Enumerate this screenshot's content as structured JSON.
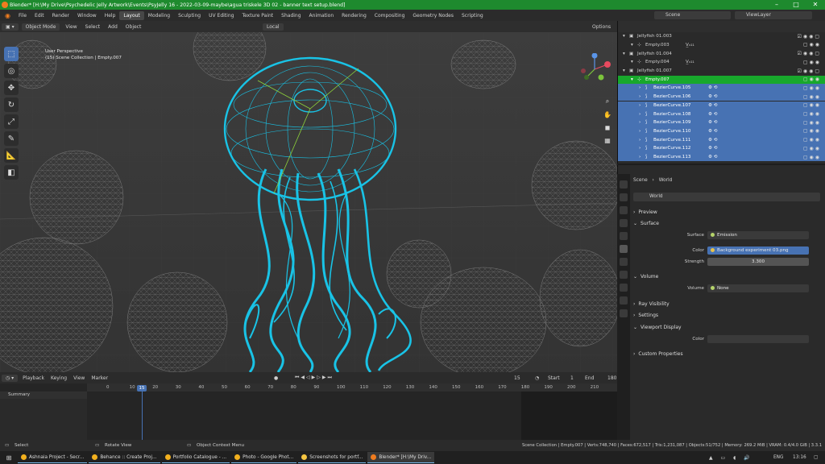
{
  "window": {
    "title": "Blender* [H:\\My Drive\\Psychedelic Jelly Artwork\\Events\\PsyJelly 16 - 2022-03-09-maybe\\agua triskele 3D 02 - banner text setup.blend]"
  },
  "menu": [
    "File",
    "Edit",
    "Render",
    "Window",
    "Help"
  ],
  "workspaces": [
    "Layout",
    "Modeling",
    "Sculpting",
    "UV Editing",
    "Texture Paint",
    "Shading",
    "Animation",
    "Rendering",
    "Compositing",
    "Geometry Nodes",
    "Scripting"
  ],
  "active_workspace": "Layout",
  "scene": {
    "scene_label": "Scene",
    "view_layer_label": "ViewLayer"
  },
  "viewport": {
    "mode": "Object Mode",
    "menu": [
      "View",
      "Select",
      "Add",
      "Object"
    ],
    "transform": "Local",
    "options": "Options",
    "perspective": "User Perspective",
    "collection_info": "(15) Scene Collection | Empty.007"
  },
  "tools": [
    "select-box",
    "cursor",
    "move",
    "rotate",
    "scale",
    "transform",
    "annotate",
    "measure",
    "add-cube"
  ],
  "outliner": {
    "rows": [
      {
        "label": "Jellyfish 01.003",
        "indent": 1,
        "state": "normal",
        "extra": ""
      },
      {
        "label": "Empty.003",
        "indent": 2,
        "state": "normal",
        "extra": "V̲ₓ₁₁"
      },
      {
        "label": "Jellyfish 01.004",
        "indent": 1,
        "state": "normal",
        "extra": ""
      },
      {
        "label": "Empty.004",
        "indent": 2,
        "state": "normal",
        "extra": "V̲ₓ₁₁"
      },
      {
        "label": "Jellyfish 01.007",
        "indent": 1,
        "state": "normal",
        "extra": ""
      },
      {
        "label": "Empty.007",
        "indent": 2,
        "state": "active",
        "extra": ""
      },
      {
        "label": "BezierCurve.105",
        "indent": 3,
        "state": "sel",
        "extra": ""
      },
      {
        "label": "BezierCurve.106",
        "indent": 3,
        "state": "sel",
        "extra": ""
      },
      {
        "label": "BezierCurve.107",
        "indent": 3,
        "state": "sel",
        "extra": ""
      },
      {
        "label": "BezierCurve.108",
        "indent": 3,
        "state": "sel",
        "extra": ""
      },
      {
        "label": "BezierCurve.109",
        "indent": 3,
        "state": "sel",
        "extra": ""
      },
      {
        "label": "BezierCurve.110",
        "indent": 3,
        "state": "sel",
        "extra": ""
      },
      {
        "label": "BezierCurve.111",
        "indent": 3,
        "state": "sel",
        "extra": ""
      },
      {
        "label": "BezierCurve.112",
        "indent": 3,
        "state": "sel",
        "extra": ""
      },
      {
        "label": "BezierCurve.113",
        "indent": 3,
        "state": "sel",
        "extra": ""
      }
    ]
  },
  "properties": {
    "breadcrumb": {
      "scene": "Scene",
      "world": "World"
    },
    "world_name": "World",
    "sections": {
      "preview": "Preview",
      "surface": "Surface",
      "volume": "Volume",
      "ray_visibility": "Ray Visibility",
      "settings": "Settings",
      "viewport_display": "Viewport Display",
      "custom": "Custom Properties"
    },
    "surface_label": "Surface",
    "surface_value": "Emission",
    "color_label": "Color",
    "color_value": "Background experiment 03.png",
    "strength_label": "Strength",
    "strength_value": "3.300",
    "volume_label": "Volume",
    "volume_value": "None",
    "vd_color_label": "Color"
  },
  "timeline": {
    "menu": [
      "Playback",
      "Keying",
      "View",
      "Marker"
    ],
    "current_frame": "15",
    "start_label": "Start",
    "start": "1",
    "end_label": "End",
    "end": "180",
    "summary": "Summary",
    "ticks": [
      "0",
      "10",
      "15",
      "20",
      "30",
      "40",
      "50",
      "60",
      "70",
      "80",
      "90",
      "100",
      "110",
      "120",
      "130",
      "140",
      "150",
      "160",
      "170",
      "180",
      "190",
      "200",
      "210"
    ]
  },
  "status": {
    "select": "Select",
    "rotate": "Rotate View",
    "context": "Object Context Menu",
    "stats": "Scene Collection | Empty.007 | Verts:748,740 | Faces:672,517 | Tris:1,231,087 | Objects:51/752 | Memory: 269.2 MiB | VRAM: 0.4/4.0 GiB | 3.3.1"
  },
  "taskbar": {
    "items": [
      {
        "label": "Ashnaia Project - Secr...",
        "color": "#f2b01e"
      },
      {
        "label": "Behance :: Create Proj...",
        "color": "#f2b01e"
      },
      {
        "label": "Portfolio Catalogue - ...",
        "color": "#f2b01e"
      },
      {
        "label": "Photo - Google Phot...",
        "color": "#f2b01e"
      },
      {
        "label": "Screenshots for portf...",
        "color": "#f5c542"
      },
      {
        "label": "Blender* [H:\\My Driv...",
        "color": "#f07c1f"
      }
    ],
    "lang": "ENG",
    "time": "13:16"
  }
}
